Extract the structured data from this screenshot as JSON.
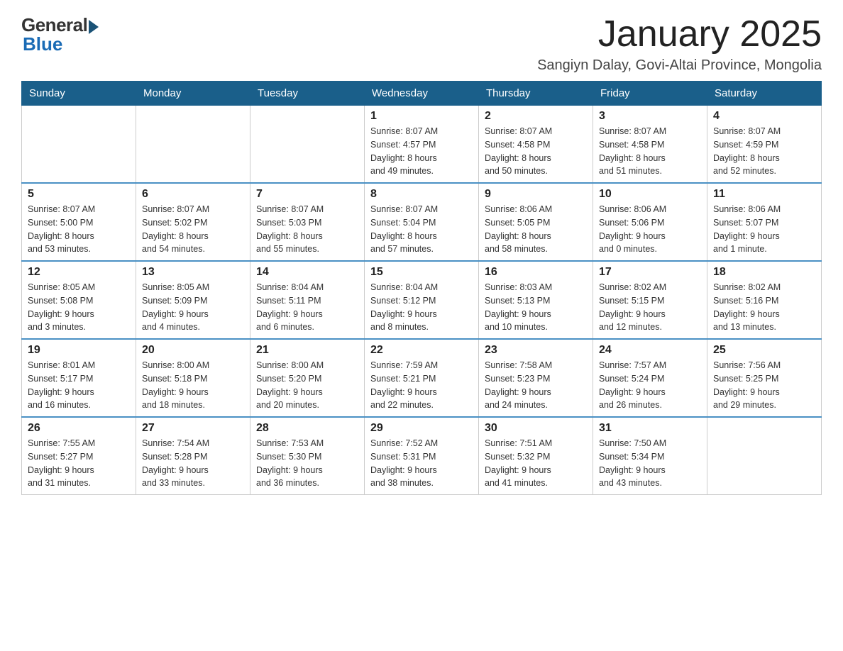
{
  "header": {
    "logo_general": "General",
    "logo_blue": "Blue",
    "month_title": "January 2025",
    "subtitle": "Sangiyn Dalay, Govi-Altai Province, Mongolia"
  },
  "days_of_week": [
    "Sunday",
    "Monday",
    "Tuesday",
    "Wednesday",
    "Thursday",
    "Friday",
    "Saturday"
  ],
  "weeks": [
    [
      {
        "day": "",
        "info": ""
      },
      {
        "day": "",
        "info": ""
      },
      {
        "day": "",
        "info": ""
      },
      {
        "day": "1",
        "info": "Sunrise: 8:07 AM\nSunset: 4:57 PM\nDaylight: 8 hours\nand 49 minutes."
      },
      {
        "day": "2",
        "info": "Sunrise: 8:07 AM\nSunset: 4:58 PM\nDaylight: 8 hours\nand 50 minutes."
      },
      {
        "day": "3",
        "info": "Sunrise: 8:07 AM\nSunset: 4:58 PM\nDaylight: 8 hours\nand 51 minutes."
      },
      {
        "day": "4",
        "info": "Sunrise: 8:07 AM\nSunset: 4:59 PM\nDaylight: 8 hours\nand 52 minutes."
      }
    ],
    [
      {
        "day": "5",
        "info": "Sunrise: 8:07 AM\nSunset: 5:00 PM\nDaylight: 8 hours\nand 53 minutes."
      },
      {
        "day": "6",
        "info": "Sunrise: 8:07 AM\nSunset: 5:02 PM\nDaylight: 8 hours\nand 54 minutes."
      },
      {
        "day": "7",
        "info": "Sunrise: 8:07 AM\nSunset: 5:03 PM\nDaylight: 8 hours\nand 55 minutes."
      },
      {
        "day": "8",
        "info": "Sunrise: 8:07 AM\nSunset: 5:04 PM\nDaylight: 8 hours\nand 57 minutes."
      },
      {
        "day": "9",
        "info": "Sunrise: 8:06 AM\nSunset: 5:05 PM\nDaylight: 8 hours\nand 58 minutes."
      },
      {
        "day": "10",
        "info": "Sunrise: 8:06 AM\nSunset: 5:06 PM\nDaylight: 9 hours\nand 0 minutes."
      },
      {
        "day": "11",
        "info": "Sunrise: 8:06 AM\nSunset: 5:07 PM\nDaylight: 9 hours\nand 1 minute."
      }
    ],
    [
      {
        "day": "12",
        "info": "Sunrise: 8:05 AM\nSunset: 5:08 PM\nDaylight: 9 hours\nand 3 minutes."
      },
      {
        "day": "13",
        "info": "Sunrise: 8:05 AM\nSunset: 5:09 PM\nDaylight: 9 hours\nand 4 minutes."
      },
      {
        "day": "14",
        "info": "Sunrise: 8:04 AM\nSunset: 5:11 PM\nDaylight: 9 hours\nand 6 minutes."
      },
      {
        "day": "15",
        "info": "Sunrise: 8:04 AM\nSunset: 5:12 PM\nDaylight: 9 hours\nand 8 minutes."
      },
      {
        "day": "16",
        "info": "Sunrise: 8:03 AM\nSunset: 5:13 PM\nDaylight: 9 hours\nand 10 minutes."
      },
      {
        "day": "17",
        "info": "Sunrise: 8:02 AM\nSunset: 5:15 PM\nDaylight: 9 hours\nand 12 minutes."
      },
      {
        "day": "18",
        "info": "Sunrise: 8:02 AM\nSunset: 5:16 PM\nDaylight: 9 hours\nand 13 minutes."
      }
    ],
    [
      {
        "day": "19",
        "info": "Sunrise: 8:01 AM\nSunset: 5:17 PM\nDaylight: 9 hours\nand 16 minutes."
      },
      {
        "day": "20",
        "info": "Sunrise: 8:00 AM\nSunset: 5:18 PM\nDaylight: 9 hours\nand 18 minutes."
      },
      {
        "day": "21",
        "info": "Sunrise: 8:00 AM\nSunset: 5:20 PM\nDaylight: 9 hours\nand 20 minutes."
      },
      {
        "day": "22",
        "info": "Sunrise: 7:59 AM\nSunset: 5:21 PM\nDaylight: 9 hours\nand 22 minutes."
      },
      {
        "day": "23",
        "info": "Sunrise: 7:58 AM\nSunset: 5:23 PM\nDaylight: 9 hours\nand 24 minutes."
      },
      {
        "day": "24",
        "info": "Sunrise: 7:57 AM\nSunset: 5:24 PM\nDaylight: 9 hours\nand 26 minutes."
      },
      {
        "day": "25",
        "info": "Sunrise: 7:56 AM\nSunset: 5:25 PM\nDaylight: 9 hours\nand 29 minutes."
      }
    ],
    [
      {
        "day": "26",
        "info": "Sunrise: 7:55 AM\nSunset: 5:27 PM\nDaylight: 9 hours\nand 31 minutes."
      },
      {
        "day": "27",
        "info": "Sunrise: 7:54 AM\nSunset: 5:28 PM\nDaylight: 9 hours\nand 33 minutes."
      },
      {
        "day": "28",
        "info": "Sunrise: 7:53 AM\nSunset: 5:30 PM\nDaylight: 9 hours\nand 36 minutes."
      },
      {
        "day": "29",
        "info": "Sunrise: 7:52 AM\nSunset: 5:31 PM\nDaylight: 9 hours\nand 38 minutes."
      },
      {
        "day": "30",
        "info": "Sunrise: 7:51 AM\nSunset: 5:32 PM\nDaylight: 9 hours\nand 41 minutes."
      },
      {
        "day": "31",
        "info": "Sunrise: 7:50 AM\nSunset: 5:34 PM\nDaylight: 9 hours\nand 43 minutes."
      },
      {
        "day": "",
        "info": ""
      }
    ]
  ]
}
